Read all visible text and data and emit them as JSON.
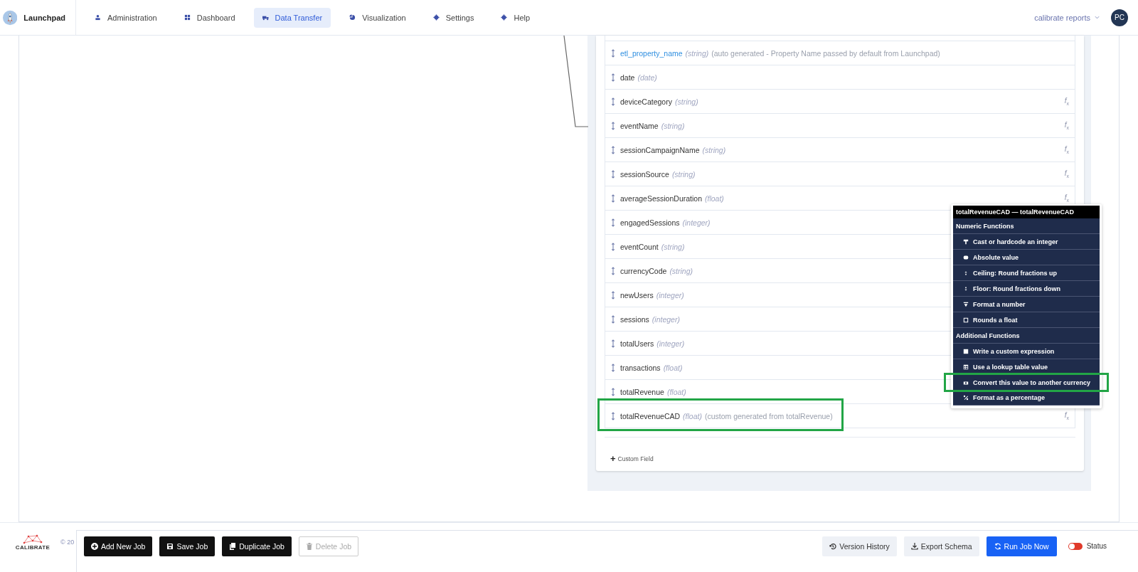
{
  "brand": {
    "name": "Launchpad"
  },
  "nav": [
    {
      "label": "Administration",
      "selected": false
    },
    {
      "label": "Dashboard",
      "selected": false
    },
    {
      "label": "Data Transfer",
      "selected": true
    },
    {
      "label": "Visualization",
      "selected": false
    },
    {
      "label": "Settings",
      "selected": false
    },
    {
      "label": "Help",
      "selected": false
    }
  ],
  "account": {
    "label": "calibrate reports",
    "avatar": "PC"
  },
  "fields": [
    {
      "name": "etl_property_name",
      "type": "(string)",
      "note": "(auto generated - Property Name passed by default from Launchpad)",
      "kind": "generated",
      "highlighted": false
    },
    {
      "name": "date",
      "type": "(date)",
      "kind": "regular",
      "highlighted": false
    },
    {
      "name": "deviceCategory",
      "type": "(string)",
      "kind": "regular",
      "function_icon": "*f*$_{x}$",
      "highlighted": false
    },
    {
      "name": "eventName",
      "type": "(string)",
      "kind": "regular",
      "function_icon": "*f*$_{x}$",
      "highlighted": false
    },
    {
      "name": "sessionCampaignName",
      "type": "(string)",
      "kind": "regular",
      "function_icon": "*f*$_{x}$",
      "highlighted": false
    },
    {
      "name": "sessionSource",
      "type": "(string)",
      "kind": "regular",
      "function_icon": "*f*$_{x}$",
      "highlighted": false
    },
    {
      "name": "averageSessionDuration",
      "type": "(float)",
      "kind": "regular",
      "function_icon": "*f*$_{x}$",
      "highlighted": false
    },
    {
      "name": "engagedSessions",
      "type": "(integer)",
      "kind": "regular",
      "highlighted": false
    },
    {
      "name": "eventCount",
      "type": "(string)",
      "kind": "regular",
      "highlighted": false
    },
    {
      "name": "currencyCode",
      "type": "(string)",
      "kind": "regular",
      "highlighted": false
    },
    {
      "name": "newUsers",
      "type": "(integer)",
      "kind": "regular",
      "highlighted": false
    },
    {
      "name": "sessions",
      "type": "(integer)",
      "kind": "regular",
      "highlighted": false
    },
    {
      "name": "totalUsers",
      "type": "(integer)",
      "kind": "regular",
      "highlighted": false
    },
    {
      "name": "transactions",
      "type": "(float)",
      "kind": "regular",
      "highlighted": false
    },
    {
      "name": "totalRevenue",
      "type": "(float)",
      "kind": "regular",
      "highlighted": false
    },
    {
      "name": "totalRevenueCAD",
      "type": "(float)",
      "note": "(custom generated from totalRevenue)",
      "kind": "custom",
      "function_icon": "*f*$_{x}$",
      "highlighted": true
    }
  ],
  "add_field": {
    "icon": "+",
    "label": "Custom Field"
  },
  "function_menu": {
    "title": "totalRevenueCAD — totalRevenueCAD",
    "sections": [
      {
        "title": "Numeric Functions",
        "items": [
          {
            "label": "Cast or hardcode an integer",
            "highlighted": false
          },
          {
            "label": "Absolute value",
            "highlighted": false
          },
          {
            "label": "Ceiling: Round fractions up",
            "highlighted": false
          },
          {
            "label": "Floor: Round fractions down",
            "highlighted": false
          },
          {
            "label": "Format a number",
            "highlighted": false
          },
          {
            "label": "Rounds a float",
            "highlighted": false
          }
        ]
      },
      {
        "title": "Additional Functions",
        "items": [
          {
            "label": "Write a custom expression",
            "highlighted": false
          },
          {
            "label": "Use a lookup table value",
            "highlighted": false
          },
          {
            "label": "Convert this value to another currency",
            "highlighted": true
          },
          {
            "label": "Format as a percentage",
            "highlighted": false
          }
        ]
      }
    ]
  },
  "footer": {
    "logo": "CALIBRATE",
    "copyright": "© 20"
  },
  "actions": [
    {
      "label": "Add New Job",
      "kind": "dark",
      "disabled": false
    },
    {
      "label": "Save Job",
      "kind": "dark",
      "disabled": false
    },
    {
      "label": "Duplicate Job",
      "kind": "dark",
      "disabled": false
    },
    {
      "label": "Delete Job",
      "kind": "outline",
      "disabled": true
    }
  ],
  "right_actions": [
    {
      "label": "Version History",
      "kind": "light"
    },
    {
      "label": "Export Schema",
      "kind": "light"
    },
    {
      "label": "Run Job Now",
      "kind": "primary"
    }
  ],
  "status": {
    "label": "Status",
    "on": false
  }
}
